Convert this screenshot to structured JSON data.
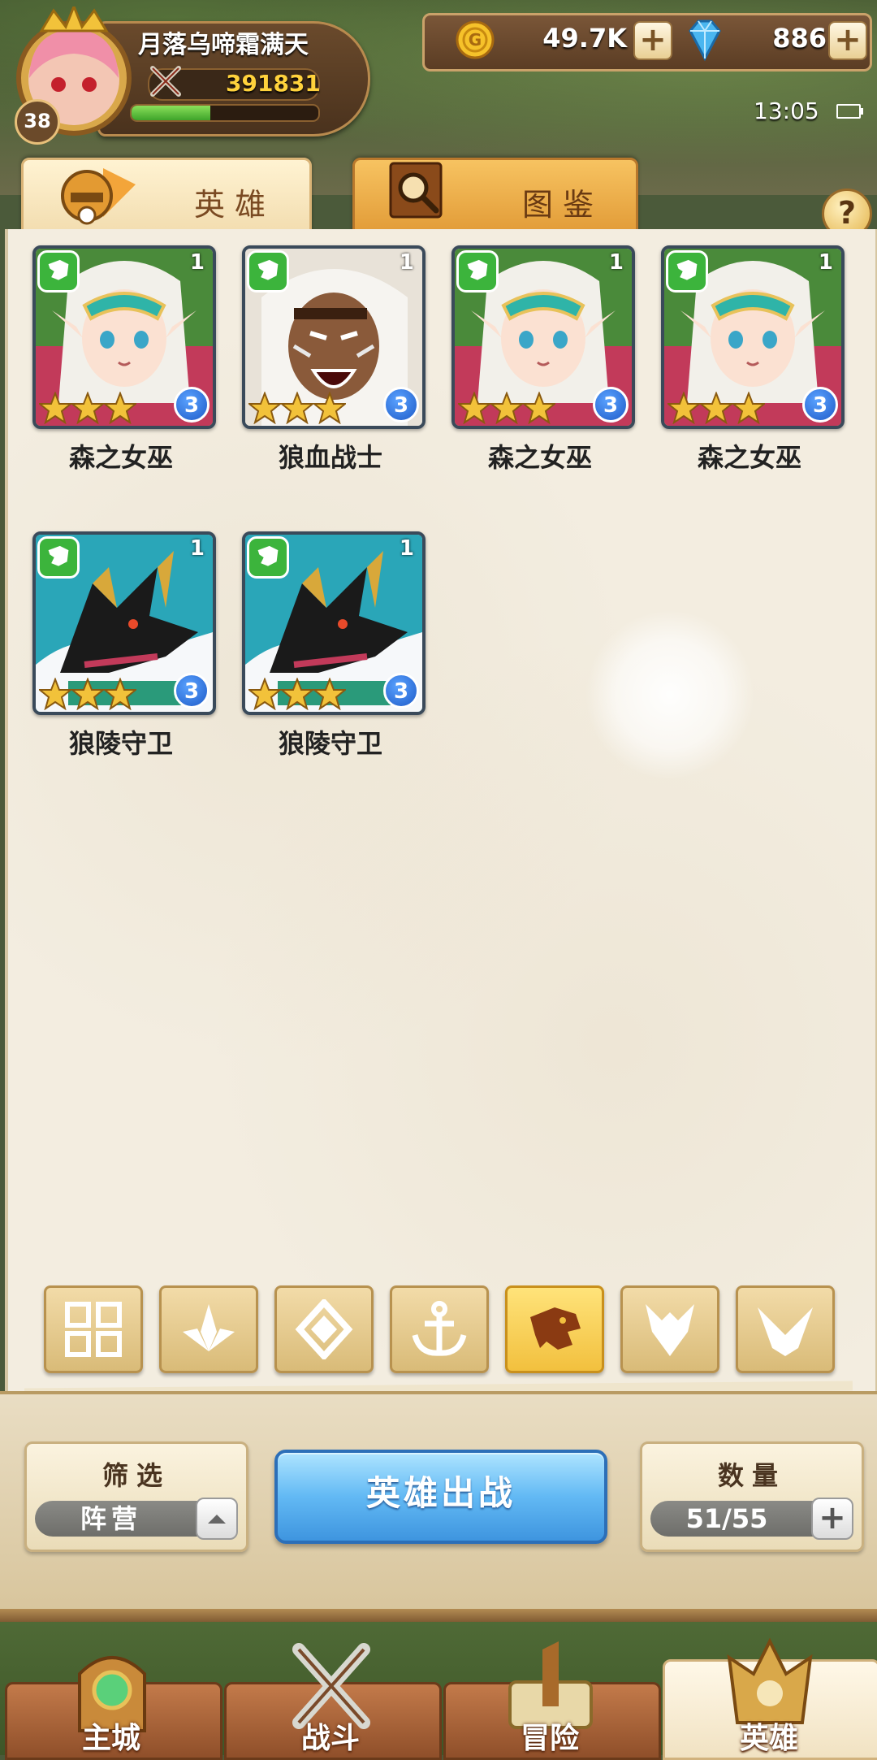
{
  "player": {
    "name": "月落乌啼霜满天",
    "power": "391831",
    "level": "38",
    "exp_progress": 0.42
  },
  "currency": {
    "gold": "49.7K",
    "gems": "886",
    "plus": "+"
  },
  "status": {
    "time": "13:05"
  },
  "tabs": [
    {
      "label": "英雄",
      "active": true
    },
    {
      "label": "图鉴",
      "active": false
    }
  ],
  "help": "?",
  "heroes": [
    {
      "name": "森之女巫",
      "count": "1",
      "stars": 3,
      "badge": "3",
      "art": "elf-witch"
    },
    {
      "name": "狼血战士",
      "count": "1",
      "stars": 3,
      "badge": "3",
      "art": "wolf-warrior"
    },
    {
      "name": "森之女巫",
      "count": "1",
      "stars": 3,
      "badge": "3",
      "art": "elf-witch"
    },
    {
      "name": "森之女巫",
      "count": "1",
      "stars": 3,
      "badge": "3",
      "art": "elf-witch"
    },
    {
      "name": "狼陵守卫",
      "count": "1",
      "stars": 3,
      "badge": "3",
      "art": "jackal-guard"
    },
    {
      "name": "狼陵守卫",
      "count": "1",
      "stars": 3,
      "badge": "3",
      "art": "jackal-guard"
    }
  ],
  "faction_filters": [
    {
      "icon": "grid-icon",
      "active": false
    },
    {
      "icon": "leaf-icon",
      "active": false
    },
    {
      "icon": "diamond-icon",
      "active": false
    },
    {
      "icon": "anchor-icon",
      "active": false
    },
    {
      "icon": "beast-icon",
      "active": true
    },
    {
      "icon": "demon-icon",
      "active": false
    },
    {
      "icon": "wing-icon",
      "active": false
    }
  ],
  "controls": {
    "filter_title": "筛选",
    "filter_value": "阵营",
    "deploy_label": "英雄出战",
    "count_title": "数量",
    "count_value": "51/55"
  },
  "nav": [
    {
      "label": "主城",
      "active": false
    },
    {
      "label": "战斗",
      "active": false
    },
    {
      "label": "冒险",
      "active": false
    },
    {
      "label": "英雄",
      "active": true
    }
  ]
}
